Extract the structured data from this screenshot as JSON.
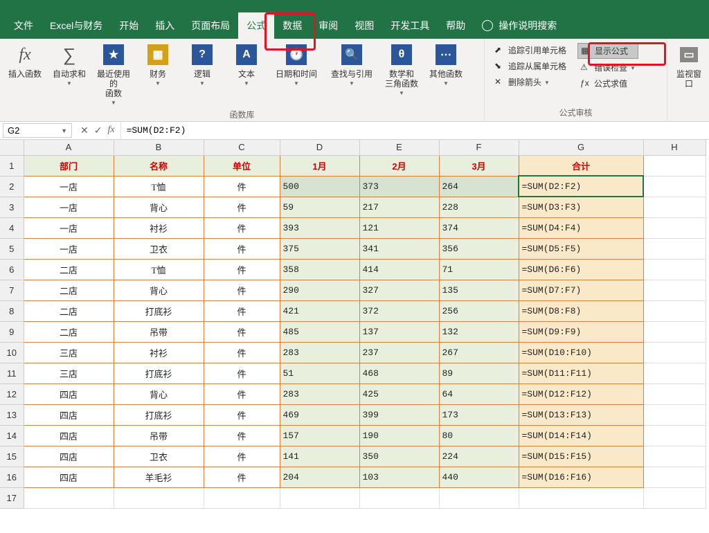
{
  "menu": {
    "file": "文件",
    "excel_finance": "Excel与财务",
    "home": "开始",
    "insert": "插入",
    "layout": "页面布局",
    "formula": "公式",
    "data": "数据",
    "review": "审阅",
    "view": "视图",
    "dev": "开发工具",
    "help": "帮助",
    "search": "操作说明搜索"
  },
  "ribbon": {
    "insert_fn": "插入函数",
    "autosum": "自动求和",
    "recent": "最近使用的\n函数",
    "finance": "财务",
    "logic": "逻辑",
    "text": "文本",
    "datetime": "日期和时间",
    "lookup": "查找与引用",
    "math": "数学和\n三角函数",
    "other": "其他函数",
    "group_fnlib": "函数库",
    "trace_prec": "追踪引用单元格",
    "trace_dep": "追踪从属单元格",
    "remove_arrow": "删除箭头",
    "show_formula": "显示公式",
    "error_check": "错误检查",
    "eval_formula": "公式求值",
    "group_audit": "公式审核",
    "watch": "监视窗口"
  },
  "fb": {
    "cell": "G2",
    "formula": "=SUM(D2:F2)"
  },
  "cols": [
    "A",
    "B",
    "C",
    "D",
    "E",
    "F",
    "G",
    "H"
  ],
  "headers": {
    "A": "部门",
    "B": "名称",
    "C": "单位",
    "D": "1月",
    "E": "2月",
    "F": "3月",
    "G": "合计"
  },
  "rows": [
    {
      "A": "一店",
      "B": "T恤",
      "C": "件",
      "D": "500",
      "E": "373",
      "F": "264",
      "G": "=SUM(D2:F2)"
    },
    {
      "A": "一店",
      "B": "背心",
      "C": "件",
      "D": "59",
      "E": "217",
      "F": "228",
      "G": "=SUM(D3:F3)"
    },
    {
      "A": "一店",
      "B": "衬衫",
      "C": "件",
      "D": "393",
      "E": "121",
      "F": "374",
      "G": "=SUM(D4:F4)"
    },
    {
      "A": "一店",
      "B": "卫衣",
      "C": "件",
      "D": "375",
      "E": "341",
      "F": "356",
      "G": "=SUM(D5:F5)"
    },
    {
      "A": "二店",
      "B": "T恤",
      "C": "件",
      "D": "358",
      "E": "414",
      "F": "71",
      "G": "=SUM(D6:F6)"
    },
    {
      "A": "二店",
      "B": "背心",
      "C": "件",
      "D": "290",
      "E": "327",
      "F": "135",
      "G": "=SUM(D7:F7)"
    },
    {
      "A": "二店",
      "B": "打底衫",
      "C": "件",
      "D": "421",
      "E": "372",
      "F": "256",
      "G": "=SUM(D8:F8)"
    },
    {
      "A": "二店",
      "B": "吊带",
      "C": "件",
      "D": "485",
      "E": "137",
      "F": "132",
      "G": "=SUM(D9:F9)"
    },
    {
      "A": "三店",
      "B": "衬衫",
      "C": "件",
      "D": "283",
      "E": "237",
      "F": "267",
      "G": "=SUM(D10:F10)"
    },
    {
      "A": "三店",
      "B": "打底衫",
      "C": "件",
      "D": "51",
      "E": "468",
      "F": "89",
      "G": "=SUM(D11:F11)"
    },
    {
      "A": "四店",
      "B": "背心",
      "C": "件",
      "D": "283",
      "E": "425",
      "F": "64",
      "G": "=SUM(D12:F12)"
    },
    {
      "A": "四店",
      "B": "打底衫",
      "C": "件",
      "D": "469",
      "E": "399",
      "F": "173",
      "G": "=SUM(D13:F13)"
    },
    {
      "A": "四店",
      "B": "吊带",
      "C": "件",
      "D": "157",
      "E": "190",
      "F": "80",
      "G": "=SUM(D14:F14)"
    },
    {
      "A": "四店",
      "B": "卫衣",
      "C": "件",
      "D": "141",
      "E": "350",
      "F": "224",
      "G": "=SUM(D15:F15)"
    },
    {
      "A": "四店",
      "B": "羊毛衫",
      "C": "件",
      "D": "204",
      "E": "103",
      "F": "440",
      "G": "=SUM(D16:F16)"
    }
  ]
}
